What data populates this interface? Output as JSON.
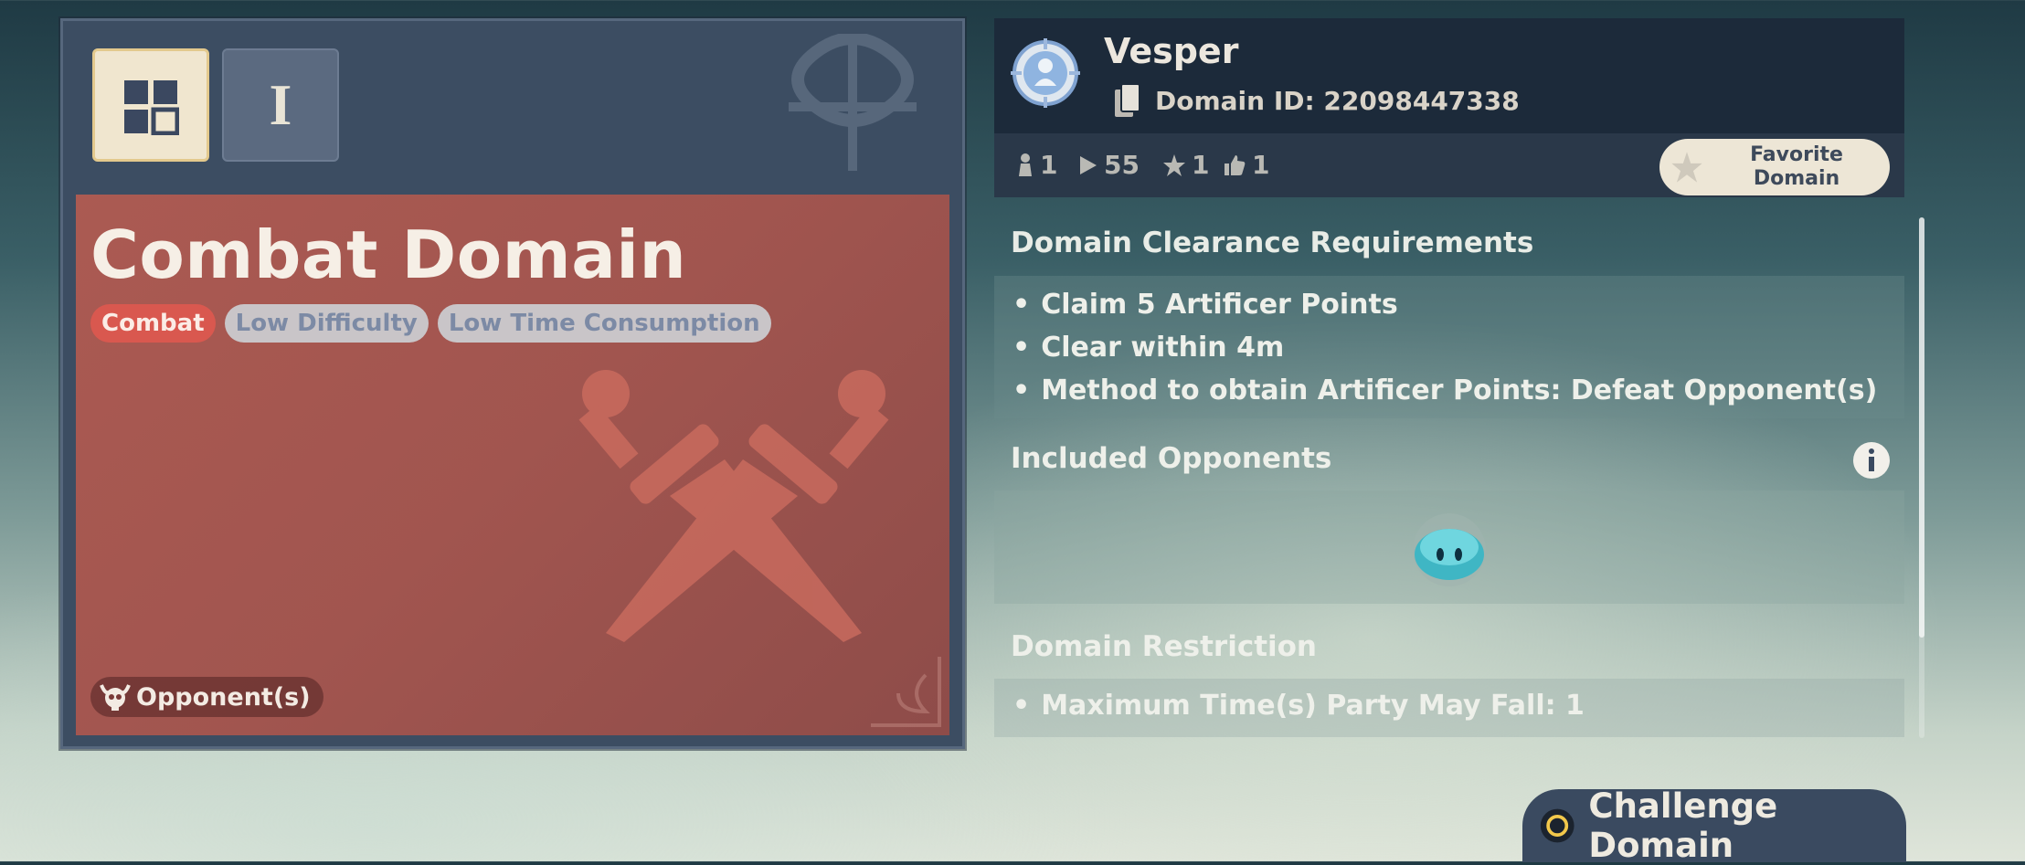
{
  "left_card": {
    "tabs": [
      {
        "name": "grid",
        "selected": true
      },
      {
        "name": "I",
        "label": "I",
        "selected": false
      }
    ],
    "title": "Combat Domain",
    "tags": [
      "Combat",
      "Low Difficulty",
      "Low Time Consumption"
    ],
    "opponents_label": "Opponent(s)"
  },
  "header": {
    "author": "Vesper",
    "domain_id": "Domain ID: 22098447338",
    "stats": {
      "players": "1",
      "plays": "55",
      "stars": "1",
      "likes": "1"
    },
    "favorite_label_line1": "Favorite",
    "favorite_label_line2": "Domain"
  },
  "requirements": {
    "title": "Domain Clearance Requirements",
    "items": [
      "Claim 5 Artificer Points",
      "Clear within 4m",
      "Method to obtain Artificer Points: Defeat Opponent(s)"
    ]
  },
  "opponents": {
    "title": "Included Opponents",
    "icons": [
      "hydro-slime-icon"
    ]
  },
  "restriction": {
    "title": "Domain Restriction",
    "items": [
      "Maximum Time(s) Party May Fall: 1"
    ]
  },
  "challenge_button": "Challenge Domain",
  "colors": {
    "panel_red": "#a1554f",
    "tag_combat": "#d9584f",
    "header_bg": "#1c2a3a",
    "accent_gold": "#e3c98d"
  }
}
